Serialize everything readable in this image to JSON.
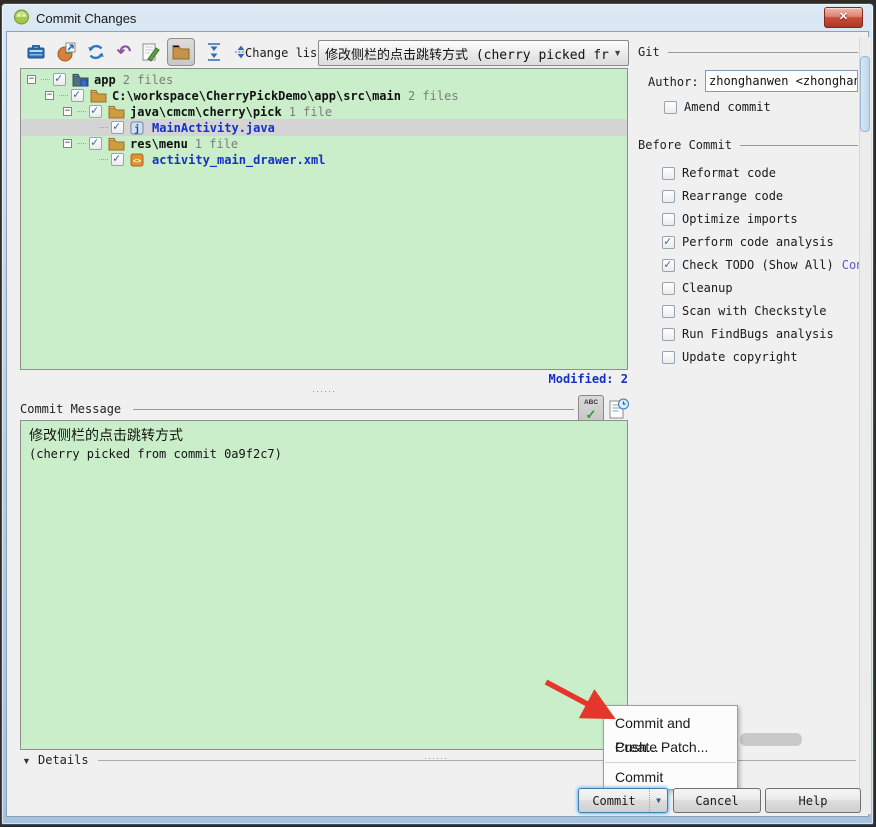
{
  "window": {
    "title": "Commit Changes"
  },
  "icons": {
    "close": "✕",
    "dropdown_arrow": "▼",
    "details_arrow": "▼",
    "revert": "↶",
    "minus": "−",
    "check": "✓",
    "abc": "ABC",
    "toolbar_names": [
      "show-diff-icon",
      "move-to-another-changelist-icon",
      "refresh-changes-icon",
      "revert-icon",
      "edit-source-icon",
      "group-by-directory-icon",
      "expand-all-icon",
      "collapse-all-icon"
    ]
  },
  "toolbar": {
    "change_list_label": "Change list:",
    "change_list_value": "修改侧栏的点击跳转方式 (cherry picked from ..."
  },
  "tree": {
    "rows": [
      {
        "label": "app",
        "suffix": "2 files",
        "type": "module"
      },
      {
        "label": "C:\\workspace\\CherryPickDemo\\app\\src\\main",
        "suffix": "2 files",
        "type": "folder"
      },
      {
        "label": "java\\cmcm\\cherry\\pick",
        "suffix": "1 file",
        "type": "folder"
      },
      {
        "label": "MainActivity.java",
        "suffix": "",
        "type": "java",
        "selected": true
      },
      {
        "label": "res\\menu",
        "suffix": "1 file",
        "type": "folder"
      },
      {
        "label": "activity_main_drawer.xml",
        "suffix": "",
        "type": "xml"
      }
    ],
    "status_label": "Modified:",
    "status_count": "2"
  },
  "git_panel": {
    "section_label": "Git",
    "author_label": "Author:",
    "author_value": "zhonghanwen <zhonghanwen@",
    "amend_label": "Amend commit",
    "before_commit_label": "Before Commit",
    "checks": [
      {
        "label": "Reformat code",
        "checked": false
      },
      {
        "label": "Rearrange code",
        "checked": false
      },
      {
        "label": "Optimize imports",
        "checked": false
      },
      {
        "label": "Perform code analysis",
        "checked": true
      },
      {
        "label": "Check TODO (Show All)",
        "checked": true,
        "link": "Configur"
      },
      {
        "label": "Cleanup",
        "checked": false
      },
      {
        "label": "Scan with Checkstyle",
        "checked": false
      },
      {
        "label": "Run FindBugs analysis",
        "checked": false
      },
      {
        "label": "Update copyright",
        "checked": false
      }
    ]
  },
  "commit_message": {
    "section_label": "Commit Message",
    "line1": "修改侧栏的点击跳转方式",
    "line2": "(cherry picked from commit 0a9f2c7)"
  },
  "details": {
    "label": "Details"
  },
  "context_menu": {
    "items": [
      "Commit and Push...",
      "Create Patch...",
      "Commit"
    ]
  },
  "footer": {
    "commit": "Commit",
    "cancel": "Cancel",
    "help": "Help"
  },
  "colors": {
    "panel_green": "#c9eec9",
    "selection_gray": "#d4d4d4",
    "file_blue": "#1430c8",
    "link_purple": "#5b5bc8",
    "close_red": "#b13524",
    "titlebar_blue": "#c6d9eb"
  }
}
